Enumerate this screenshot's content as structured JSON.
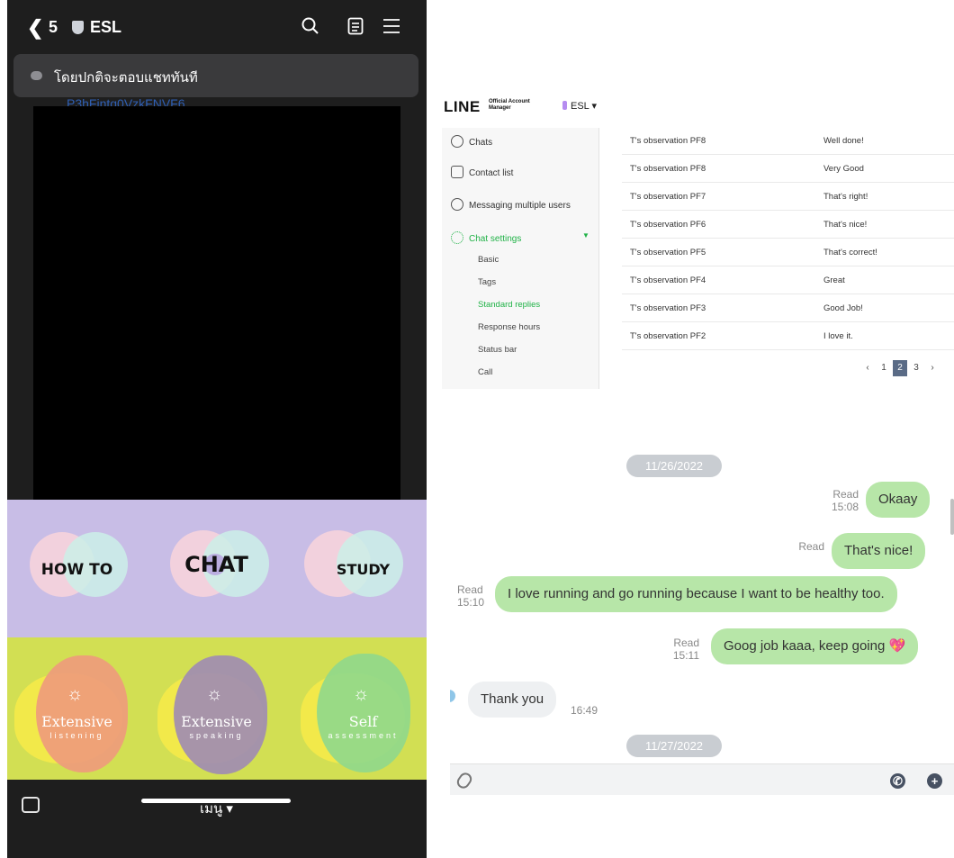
{
  "phone": {
    "header": {
      "back_count": "5",
      "title": "ESL"
    },
    "notice": "โดยปกติจะตอบแชททันที",
    "peek_text": "P3hFjntq0VzkFNVF6",
    "rich_menu_top": [
      "HOW TO",
      "CHAT",
      "STUDY"
    ],
    "rich_menu_bottom": [
      {
        "title": "Extensive",
        "subtitle": "listening"
      },
      {
        "title": "Extensive",
        "subtitle": "speaking"
      },
      {
        "title": "Self",
        "subtitle": "assessment"
      }
    ],
    "footer": {
      "menu_label": "เมนู ▾"
    }
  },
  "oa": {
    "logo": "LINE",
    "logo_small": "Official Account Manager",
    "account": "ESL ▾",
    "sidebar": {
      "items": [
        "Chats",
        "Contact list",
        "Messaging multiple users",
        "Chat settings"
      ],
      "settings_sub": [
        "Basic",
        "Tags",
        "Standard replies",
        "Response hours",
        "Status bar",
        "Call"
      ],
      "active_sub": "Standard replies"
    },
    "table": {
      "rows": [
        {
          "name": "T's observation PF8",
          "reply": "Well done!"
        },
        {
          "name": "T's observation PF8",
          "reply": "Very Good"
        },
        {
          "name": "T's observation PF7",
          "reply": "That's right!"
        },
        {
          "name": "T's observation PF6",
          "reply": "That's nice!"
        },
        {
          "name": "T's observation PF5",
          "reply": "That's correct!"
        },
        {
          "name": "T's observation PF4",
          "reply": "Great"
        },
        {
          "name": "T's observation PF3",
          "reply": "Good Job!"
        },
        {
          "name": "T's observation PF2",
          "reply": "I love it."
        }
      ]
    },
    "pager": {
      "prev": "‹",
      "pages": [
        "1",
        "2",
        "3"
      ],
      "current": "2",
      "next": "›"
    }
  },
  "chat": {
    "date1": "11/26/2022",
    "messages": [
      {
        "text": "Okaay",
        "read": "Read",
        "time": "15:08"
      },
      {
        "text": "That's nice!",
        "read": "Read",
        "time": ""
      },
      {
        "text": "I love running and go running because I want to be healthy too.",
        "read": "Read",
        "time": "15:10"
      },
      {
        "text": "Goog job kaaa, keep going 💖",
        "read": "Read",
        "time": "15:11"
      },
      {
        "text": "Thank you",
        "time": "16:49"
      }
    ],
    "date2": "11/27/2022"
  },
  "colors": {
    "menu_top_bg": "#c8bde6",
    "menu_bottom_bg": "#d2df53",
    "bubble_mine": "#b7e6a8",
    "line_green": "#20b247"
  }
}
